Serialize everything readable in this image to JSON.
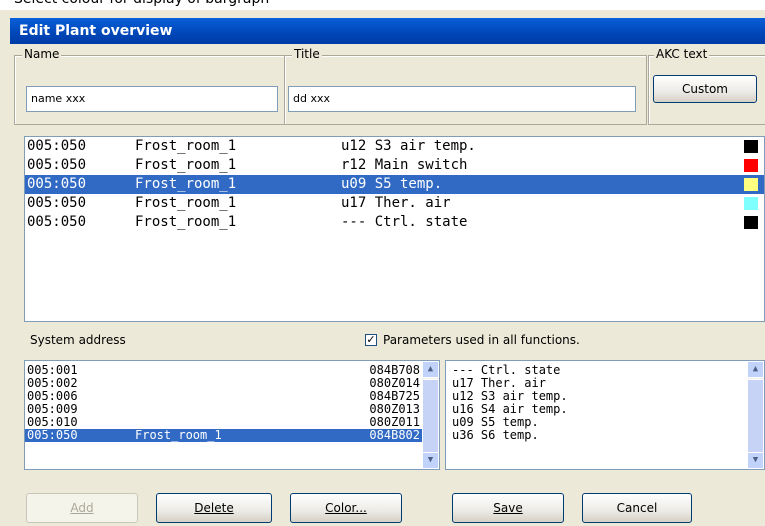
{
  "hint_text": "Select colour for display of bargraph",
  "window_title": "Edit Plant overview",
  "name_group": {
    "label": "Name",
    "value": "name xxx"
  },
  "title_group": {
    "label": "Title",
    "value": "dd xxx"
  },
  "akc_group": {
    "label": "AKC text",
    "custom_button": "Custom"
  },
  "main_rows": [
    {
      "address": "005:050",
      "unit": "Frost_room_1",
      "parameter": "u12 S3 air temp.",
      "color": "#000000"
    },
    {
      "address": "005:050",
      "unit": "Frost_room_1",
      "parameter": "r12 Main switch",
      "color": "#ff0000"
    },
    {
      "address": "005:050",
      "unit": "Frost_room_1",
      "parameter": "u09 S5 temp.",
      "color": "#ffff80"
    },
    {
      "address": "005:050",
      "unit": "Frost_room_1",
      "parameter": "u17 Ther. air",
      "color": "#80ffff"
    },
    {
      "address": "005:050",
      "unit": "Frost_room_1",
      "parameter": "--- Ctrl. state",
      "color": "#000000"
    }
  ],
  "system_address_label": "System address",
  "params_checkbox": {
    "label": "Parameters used in all functions.",
    "checked": true,
    "mark": "✓"
  },
  "system_rows": [
    {
      "address": "005:001",
      "name": "",
      "code": "084B708"
    },
    {
      "address": "005:002",
      "name": "",
      "code": "080Z014"
    },
    {
      "address": "005:006",
      "name": "",
      "code": "084B725"
    },
    {
      "address": "005:009",
      "name": "",
      "code": "080Z013"
    },
    {
      "address": "005:010",
      "name": "",
      "code": "080Z011"
    },
    {
      "address": "005:050",
      "name": "Frost_room_1",
      "code": "084B802"
    }
  ],
  "param_rows": [
    "--- Ctrl. state",
    "u17 Ther. air",
    "u12 S3 air temp.",
    "u16 S4 air temp.",
    "u09 S5 temp.",
    "u36 S6 temp."
  ],
  "buttons": {
    "add": "Add",
    "delete": "Delete",
    "color": "Color...",
    "save": "Save",
    "cancel": "Cancel"
  },
  "colors": {
    "selection": "#316ac5",
    "titlebar": "#0054e3"
  }
}
